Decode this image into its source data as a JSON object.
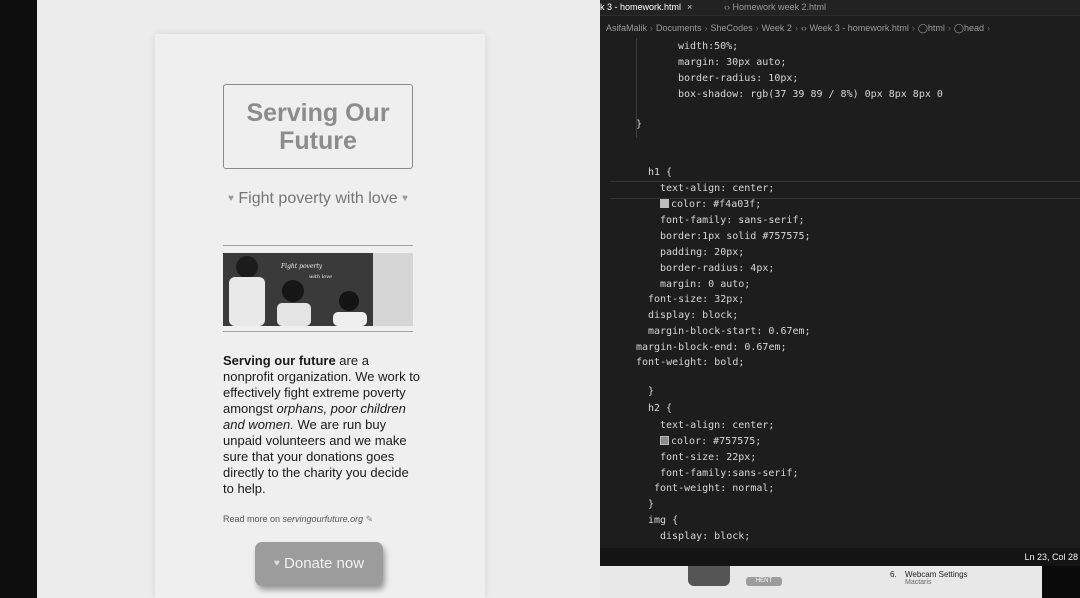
{
  "preview": {
    "heading": "Serving Our Future",
    "tagline": "Fight poverty with love",
    "photo_text_line1": "Fight poverty",
    "photo_text_line2": "with love",
    "about_bold": "Serving our future",
    "about_part1": " are a nonprofit organization. We work to effectively fight extreme poverty amongst ",
    "about_italic": "orphans, poor children and women.",
    "about_part2": " We are run buy unpaid volunteers and we make sure that your donations goes directly to the charity you decide to help.",
    "readmore_prefix": "Read more on ",
    "readmore_link": "servingourfuture.org",
    "donate_label": "Donate now"
  },
  "editor": {
    "tab_active": "k 3 - homework.html",
    "tab_close": "×",
    "tab_inactive": "Homework week 2.html",
    "breadcrumbs": [
      "AsifaMalik",
      "Documents",
      "SheCodes",
      "Week 2",
      "Week 3 - homework.html",
      "html",
      "head"
    ],
    "lines": [
      "width:50%;",
      "margin: 30px auto;",
      "border-radius: 10px;",
      "box-shadow: rgb(37 39 89 / 8%) 0px 8px 8px 0",
      "}",
      "h1 {",
      "text-align: center;",
      "color: #f4a03f;",
      "font-family: sans-serif;",
      "border:1px solid #757575;",
      "padding: 20px;",
      "border-radius: 4px;",
      "margin: 0 auto;",
      "font-size: 32px;",
      "display: block;",
      "margin-block-start: 0.67em;",
      "margin-block-end: 0.67em;",
      "font-weight: bold;",
      "}",
      "h2 {",
      "text-align: center;",
      "color: #757575;",
      "font-size: 22px;",
      "font-family:sans-serif;",
      "font-weight: normal;",
      "}",
      "img {",
      "display: block;"
    ],
    "status": "Ln 23, Col 28"
  },
  "strip": {
    "badge": "HENT",
    "menu_number": "6.",
    "menu_title": "Webcam Settings",
    "menu_sub": "Mactaris"
  },
  "colors": {
    "swatch_orange": "#f4a03f",
    "swatch_gray": "#757575"
  }
}
